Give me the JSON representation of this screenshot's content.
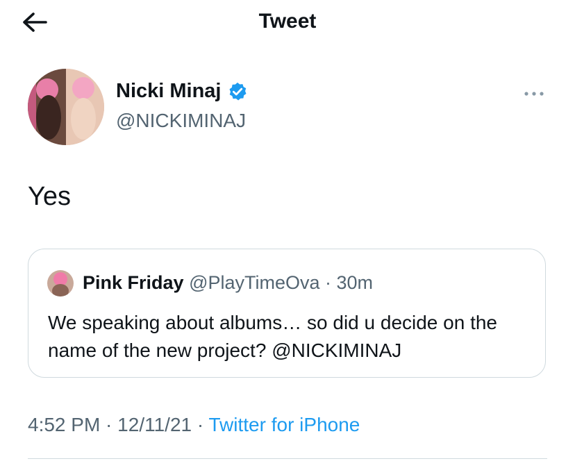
{
  "header": {
    "title": "Tweet",
    "back_icon": "arrow-left-icon"
  },
  "tweet": {
    "author": {
      "name": "Nicki Minaj",
      "handle": "@NICKIMINAJ",
      "verified": true,
      "verified_color": "#1d9bf0"
    },
    "text": "Yes",
    "more_icon": "more-horizontal-icon",
    "quote": {
      "author_name": "Pink Friday",
      "handle": "@PlayTimeOva",
      "separator": " · ",
      "time": "30m",
      "text": "We speaking about albums… so did u decide on the name of the new project? @NICKIMINAJ"
    },
    "timestamp": {
      "time": "4:52 PM",
      "separator": " · ",
      "date": "12/11/21",
      "separator2": " · ",
      "source": "Twitter for iPhone"
    }
  },
  "colors": {
    "text": "#0f1419",
    "secondary": "#536471",
    "link": "#1d9bf0",
    "border": "#cfd9de"
  }
}
